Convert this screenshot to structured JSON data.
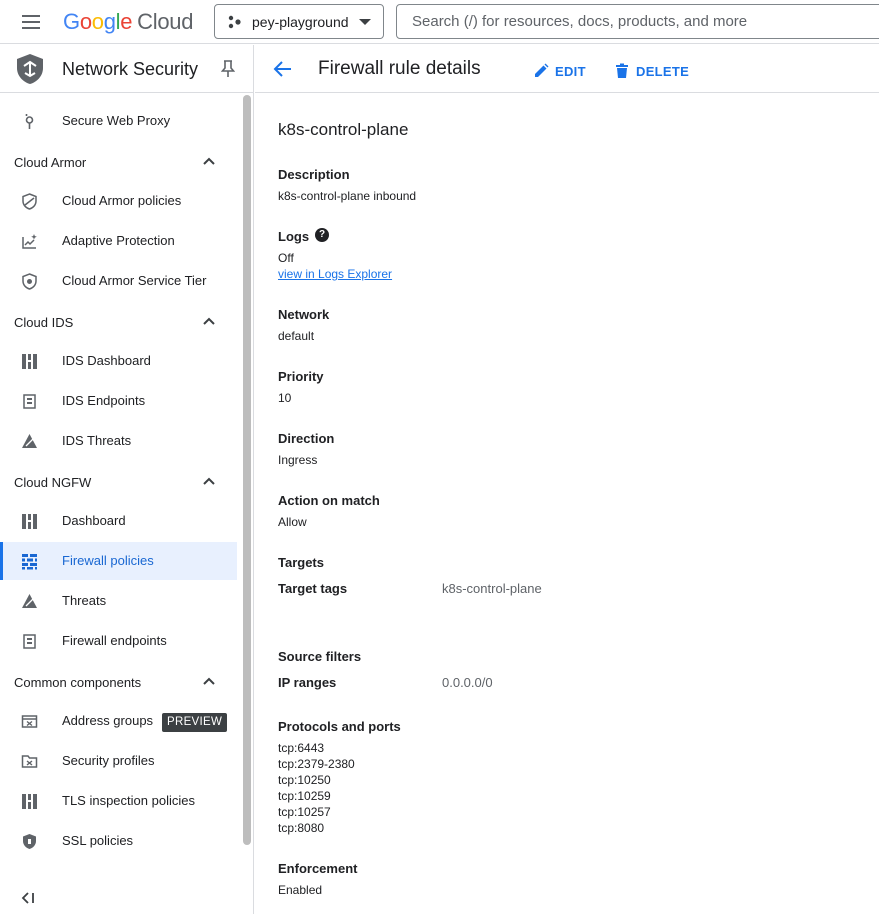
{
  "header": {
    "logo_google": "Google",
    "logo_cloud": "Cloud",
    "project": "pey-playground",
    "search_placeholder": "Search (/) for resources, docs, products, and more"
  },
  "sidebar": {
    "title": "Network Security",
    "items": [
      {
        "label": "Secure Web Proxy",
        "icon": "proxy-icon"
      },
      {
        "section": "Cloud Armor"
      },
      {
        "label": "Cloud Armor policies",
        "icon": "shield-slash-icon"
      },
      {
        "label": "Adaptive Protection",
        "icon": "chart-sparkle-icon"
      },
      {
        "label": "Cloud Armor Service Tier",
        "icon": "shield-icon"
      },
      {
        "section": "Cloud IDS"
      },
      {
        "label": "IDS Dashboard",
        "icon": "dashboard-icon"
      },
      {
        "label": "IDS Endpoints",
        "icon": "endpoint-icon"
      },
      {
        "label": "IDS Threats",
        "icon": "threats-icon"
      },
      {
        "section": "Cloud NGFW"
      },
      {
        "label": "Dashboard",
        "icon": "dashboard-icon"
      },
      {
        "label": "Firewall policies",
        "icon": "firewall-icon",
        "active": true
      },
      {
        "label": "Threats",
        "icon": "threats-icon"
      },
      {
        "label": "Firewall endpoints",
        "icon": "endpoint-icon"
      },
      {
        "section": "Common components"
      },
      {
        "label": "Address groups",
        "icon": "address-group-icon",
        "badge": "PREVIEW"
      },
      {
        "label": "Security profiles",
        "icon": "security-profile-icon"
      },
      {
        "label": "TLS inspection policies",
        "icon": "dashboard-icon"
      },
      {
        "label": "SSL policies",
        "icon": "ssl-shield-icon"
      }
    ]
  },
  "page": {
    "title": "Firewall rule details",
    "edit_label": "EDIT",
    "delete_label": "DELETE",
    "rule_name": "k8s-control-plane",
    "description_label": "Description",
    "description_value": "k8s-control-plane inbound",
    "logs_label": "Logs",
    "logs_value": "Off",
    "logs_link": "view in Logs Explorer",
    "network_label": "Network",
    "network_value": "default",
    "priority_label": "Priority",
    "priority_value": "10",
    "direction_label": "Direction",
    "direction_value": "Ingress",
    "action_label": "Action on match",
    "action_value": "Allow",
    "targets_label": "Targets",
    "target_tags_label": "Target tags",
    "target_tags_value": "k8s-control-plane",
    "source_filters_label": "Source filters",
    "ip_ranges_label": "IP ranges",
    "ip_ranges_value": "0.0.0.0/0",
    "protocols_label": "Protocols and ports",
    "ports": [
      "tcp:6443",
      "tcp:2379-2380",
      "tcp:10250",
      "tcp:10259",
      "tcp:10257",
      "tcp:8080"
    ],
    "enforcement_label": "Enforcement",
    "enforcement_value": "Enabled"
  },
  "colors": {
    "accent": "#1a73e8",
    "active_bg": "#e8f0fe",
    "badge_bg": "#3c4043"
  }
}
